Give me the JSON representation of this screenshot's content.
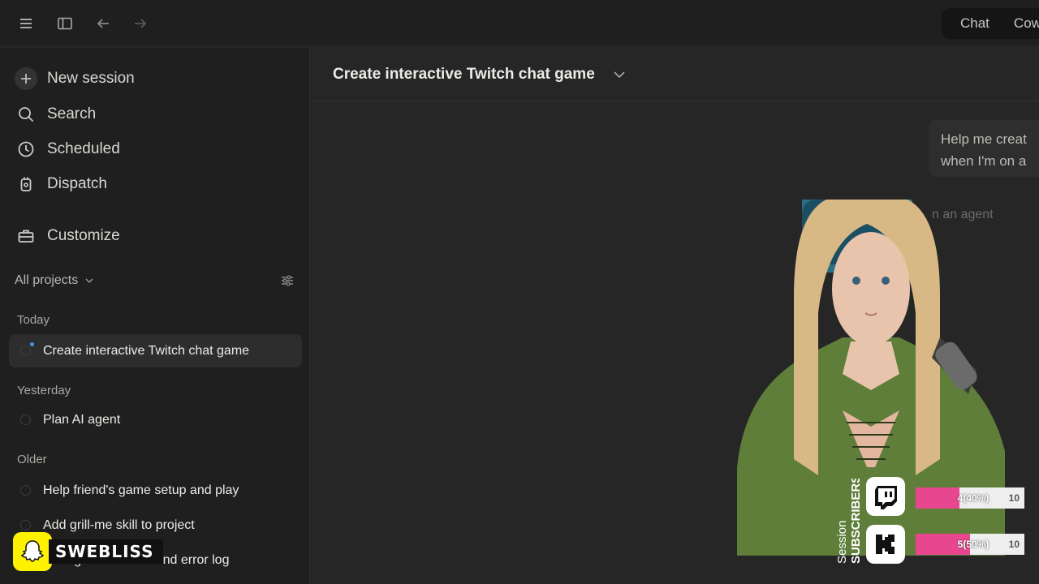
{
  "topbar": {
    "icons": [
      "menu-icon",
      "sidebar-toggle-icon",
      "back-arrow-icon",
      "forward-arrow-icon"
    ],
    "modes": [
      "Chat",
      "Cow"
    ]
  },
  "sidebar": {
    "nav": [
      {
        "label": "New session",
        "icon": "plus-icon"
      },
      {
        "label": "Search",
        "icon": "search-icon"
      },
      {
        "label": "Scheduled",
        "icon": "clock-icon"
      },
      {
        "label": "Dispatch",
        "icon": "dispatch-icon"
      },
      {
        "label": "Customize",
        "icon": "toolbox-icon"
      }
    ],
    "projects_label": "All projects",
    "sections": [
      {
        "heading": "Today",
        "sessions": [
          "Create interactive Twitch chat game"
        ]
      },
      {
        "heading": "Yesterday",
        "sessions": [
          "Plan AI agent"
        ]
      },
      {
        "heading": "Older",
        "sessions": [
          "Help friend's game setup and play",
          "Add grill-me skill to project",
          "Debug OBS freeze and error log"
        ]
      }
    ]
  },
  "main": {
    "title": "Create interactive Twitch chat game",
    "user_message_lines": [
      "Help me creat",
      "when I'm on a"
    ],
    "agent_note": "n an agent"
  },
  "overlay": {
    "streamer_name": "SWEBLISS",
    "session_label": "Session",
    "subscribers_label": "SUBSCRIBERS",
    "goals": [
      {
        "platform": "twitch",
        "text": "4(40%)",
        "goal": "10",
        "progress": 0.4
      },
      {
        "platform": "kick",
        "text": "5(50%)",
        "goal": "10",
        "progress": 0.5
      }
    ]
  },
  "colors": {
    "accent_pink": "#e8478f",
    "snap_yellow": "#fff200",
    "unread_blue": "#4a8fe8"
  }
}
